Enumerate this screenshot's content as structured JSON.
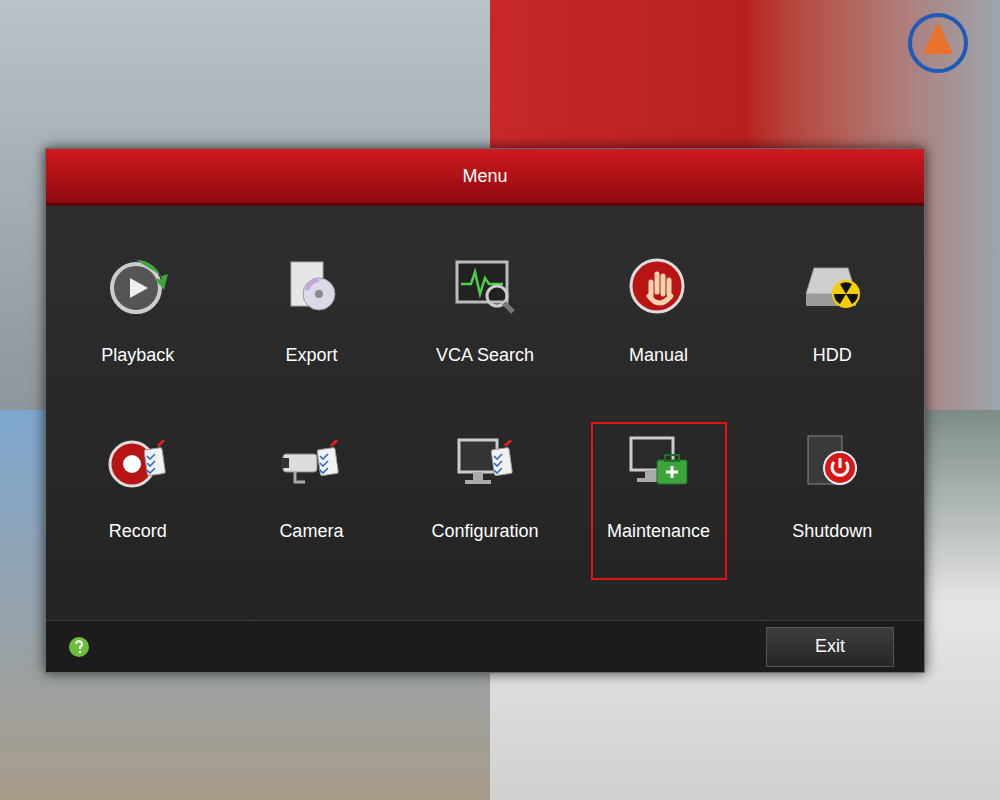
{
  "window": {
    "title": "Menu"
  },
  "items": [
    {
      "label": "Playback",
      "selected": false
    },
    {
      "label": "Export",
      "selected": false
    },
    {
      "label": "VCA Search",
      "selected": false
    },
    {
      "label": "Manual",
      "selected": false
    },
    {
      "label": "HDD",
      "selected": false
    },
    {
      "label": "Record",
      "selected": false
    },
    {
      "label": "Camera",
      "selected": false
    },
    {
      "label": "Configuration",
      "selected": false
    },
    {
      "label": "Maintenance",
      "selected": true
    },
    {
      "label": "Shutdown",
      "selected": false
    }
  ],
  "footer": {
    "exit": "Exit"
  }
}
